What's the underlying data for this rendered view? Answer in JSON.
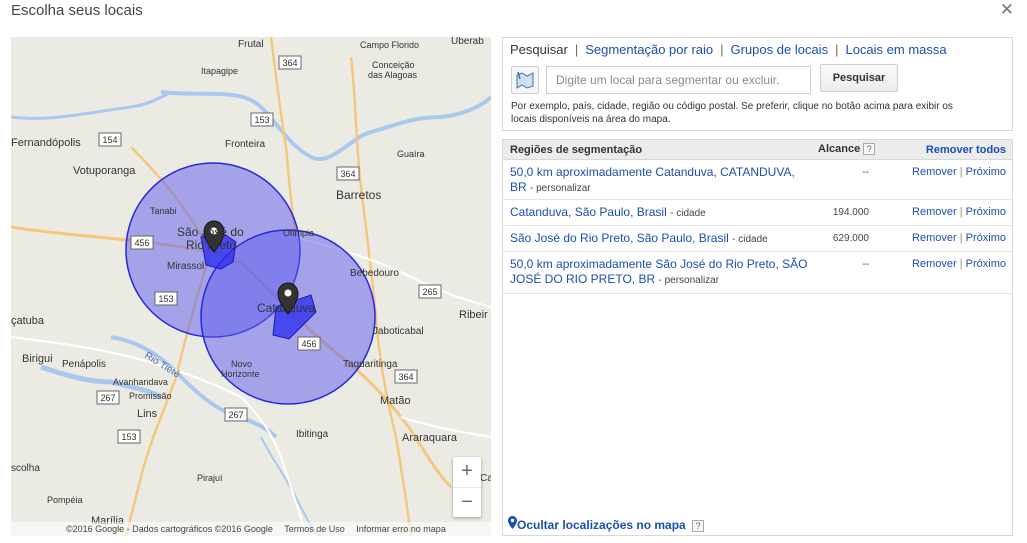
{
  "dialog": {
    "title": "Escolha seus locais",
    "close_symbol": "✕"
  },
  "map": {
    "labels": {
      "ferndopolis": "Fernandópolis",
      "votuporanga": "Votuporanga",
      "itapagipe": "Itapagipe",
      "frutal": "Frutal",
      "campo_florido": "Campo Florido",
      "uberaba": "Uberab",
      "conceicao": "Conceição",
      "das_alagoas": "das Alagoas",
      "fronteira": "Fronteira",
      "guaira": "Guaíra",
      "barretos": "Barretos",
      "tanabi": "Tanabi",
      "sjrp_1": "São José do",
      "sjrp_2": "Rio Preto",
      "mirassol": "Mirassol",
      "olimpia": "Olímpia",
      "bebedouro": "Bebedouro",
      "catanduva": "Catanduva",
      "jaboticabal": "Jaboticabal",
      "ribeir": "Ribeir",
      "acatuba": "çatuba",
      "birigui": "Birigui",
      "penapolis": "Penápolis",
      "avanhandava": "Avanhandava",
      "rio_tiete": "Rio Tietê",
      "novo_horizonte_1": "Novo",
      "novo_horizonte_2": "Horizonte",
      "taquaritinga": "Taquaritinga",
      "matao": "Matão",
      "promissao": "Promissão",
      "lins": "Lins",
      "ibitinga": "Ibitinga",
      "araraquara": "Araraquara",
      "escolha": "scolha",
      "pirajui": "Pirajuí",
      "pompeia": "Pompéia",
      "marilia": "Marília",
      "ca": "Ca"
    },
    "shields": {
      "r154": "154",
      "r364a": "364",
      "r153a": "153",
      "r364b": "364",
      "r456a": "456",
      "r153b": "153",
      "r265": "265",
      "r456b": "456",
      "r364c": "364",
      "r267a": "267",
      "r267b": "267",
      "r153c": "153"
    },
    "zoom_in": "+",
    "zoom_out": "−",
    "footer": {
      "copyright": "©2016 Google - Dados cartográficos ©2016 Google",
      "terms": "Termos de Uso",
      "report": "Informar erro no mapa"
    }
  },
  "search": {
    "tabs": {
      "pesquisar": "Pesquisar",
      "segmentacao": "Segmentação por raio",
      "grupos": "Grupos de locais",
      "massa": "Locais em massa"
    },
    "separator": "|",
    "input_placeholder": "Digite um local para segmentar ou excluir.",
    "button": "Pesquisar",
    "hint": "Por exemplo, país, cidade, região ou código postal. Se preferir, clique no botão acima para exibir os locais disponíveis na área do mapa."
  },
  "regions": {
    "header_name": "Regiões de segmentação",
    "header_reach": "Alcance",
    "help_symbol": "?",
    "remove_all": "Remover todos",
    "rows": [
      {
        "name": "50,0 km aproximadamente Catanduva, CATANDUVA, BR",
        "type": "- personalizar",
        "reach": "--",
        "remove": "Remover",
        "sep": "|",
        "next": "Próximo"
      },
      {
        "name": "Catanduva, São Paulo, Brasil",
        "type": "- cidade",
        "reach": "194.000",
        "remove": "Remover",
        "sep": "|",
        "next": "Próximo"
      },
      {
        "name": "São José do Rio Preto, São Paulo, Brasil",
        "type": "- cidade",
        "reach": "629.000",
        "remove": "Remover",
        "sep": "|",
        "next": "Próximo"
      },
      {
        "name": "50,0 km aproximadamente São José do Rio Preto, SÃO JOSÉ DO RIO PRETO, BR",
        "type": "- personalizar",
        "reach": "--",
        "remove": "Remover",
        "sep": "|",
        "next": "Próximo"
      }
    ],
    "hide_locations": "Ocultar localizações no mapa"
  },
  "colors": {
    "link": "#1a4fb0",
    "radius_fill": "#5b5bf0",
    "radius_stroke": "#2727d9",
    "road_major": "#f5c77e",
    "water": "#a8c8f0"
  }
}
